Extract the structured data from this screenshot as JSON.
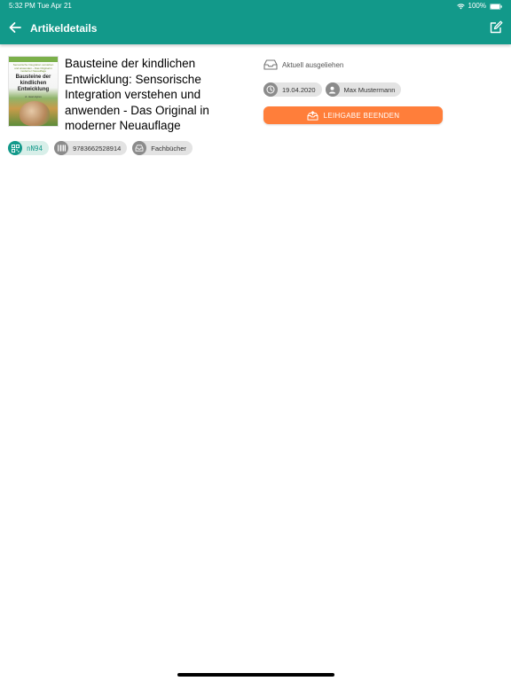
{
  "status_bar": {
    "time": "5:32 PM",
    "date": "Tue Apr 21",
    "battery": "100%",
    "icons": [
      "wifi-icon",
      "battery-icon"
    ]
  },
  "header": {
    "title": "Artikeldetails",
    "back_icon": "arrow-left-icon",
    "edit_icon": "edit-icon"
  },
  "item": {
    "cover": {
      "small_text": "Sensorische Integration verstehen und anwenden – Das Original in moderner Neuauflage",
      "title": "Bausteine der kindlichen Entwicklung",
      "author": "A. Jean Ayres"
    },
    "title": "Bausteine der kindlichen Entwicklung: Sensorische Integration verstehen und anwenden - Das Original in moderner Neuauflage",
    "code": "nN94",
    "isbn": "9783662528914",
    "category": "Fachbücher"
  },
  "loan": {
    "status": "Aktuell ausgeliehen",
    "date": "19.04.2020",
    "borrower": "Max Mustermann",
    "end_button_label": "LEIHGABE BEENDEN"
  },
  "colors": {
    "header": "#12998a",
    "accent_button": "#ff7e3a",
    "chip_bg": "#e3e3e3",
    "code_chip_bg": "#d8efe9"
  }
}
